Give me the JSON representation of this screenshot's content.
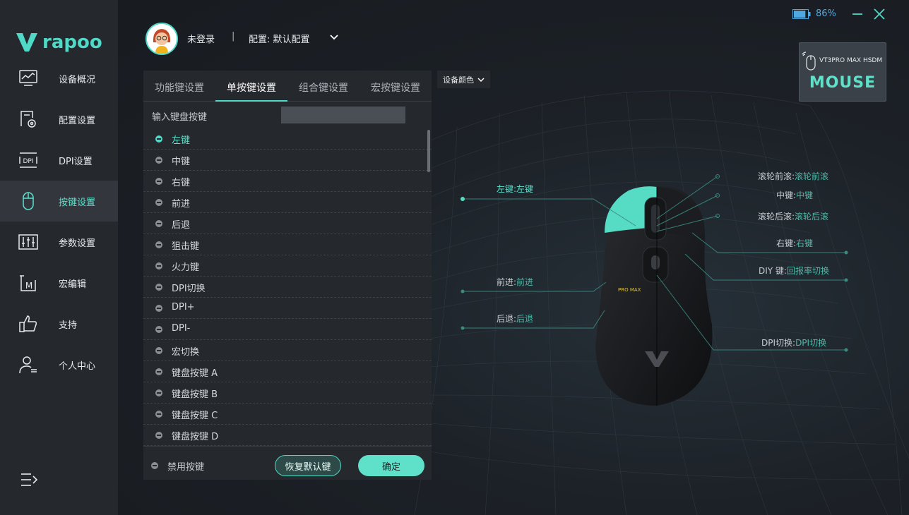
{
  "brand": {
    "logo_text": "rapoo"
  },
  "sidebar": {
    "items": [
      {
        "label": "设备概况",
        "icon": "monitor-chart-icon"
      },
      {
        "label": "配置设置",
        "icon": "config-gear-icon"
      },
      {
        "label": "DPI设置",
        "icon": "dpi-icon"
      },
      {
        "label": "按键设置",
        "icon": "mouse-icon"
      },
      {
        "label": "参数设置",
        "icon": "sliders-icon"
      },
      {
        "label": "宏编辑",
        "icon": "macro-icon"
      },
      {
        "label": "支持",
        "icon": "thumbs-up-icon"
      },
      {
        "label": "个人中心",
        "icon": "user-icon"
      }
    ],
    "active_index": 3
  },
  "header": {
    "user": "未登录",
    "separator": "|",
    "config_label": "配置: 默认配置",
    "battery_pct": "86%",
    "battery_level": 0.86
  },
  "device": {
    "name": "VT3PRO MAX HSDM",
    "type": "MOUSE"
  },
  "panel": {
    "tabs": [
      "功能键设置",
      "单按键设置",
      "组合键设置",
      "宏按键设置"
    ],
    "active_tab": 1,
    "kb_input_label": "输入键盘按键",
    "keys": [
      "左键",
      "中键",
      "右键",
      "前进",
      "后退",
      "狙击键",
      "火力键",
      "DPI切换",
      "DPI+",
      "DPI-",
      "宏切换",
      "键盘按键 A",
      "键盘按键 B",
      "键盘按键 C",
      "键盘按键 D"
    ],
    "selected_key": 0,
    "disable_label": "禁用按键",
    "reset_label": "恢复默认键",
    "ok_label": "确定"
  },
  "device_color_label": "设备颜色",
  "callouts": {
    "left_btn": {
      "k": "左键:",
      "v": "左键"
    },
    "forward": {
      "k": "前进:",
      "v": "前进"
    },
    "back": {
      "k": "后退:",
      "v": "后退"
    },
    "scroll_up": {
      "k": "滚轮前滚:",
      "v": "滚轮前滚"
    },
    "middle": {
      "k": "中键:",
      "v": "中键"
    },
    "scroll_down": {
      "k": "滚轮后滚:",
      "v": "滚轮后滚"
    },
    "right_btn": {
      "k": "右键:",
      "v": "右键"
    },
    "diy": {
      "k": "DIY 键:",
      "v": "回报率切换"
    },
    "dpi": {
      "k": "DPI切换:",
      "v": "DPI切换"
    }
  },
  "mouse_label": "PRO MAX",
  "colors": {
    "accent": "#4fd9c6",
    "sidebar": "#25282d",
    "panel": "#25282d"
  }
}
